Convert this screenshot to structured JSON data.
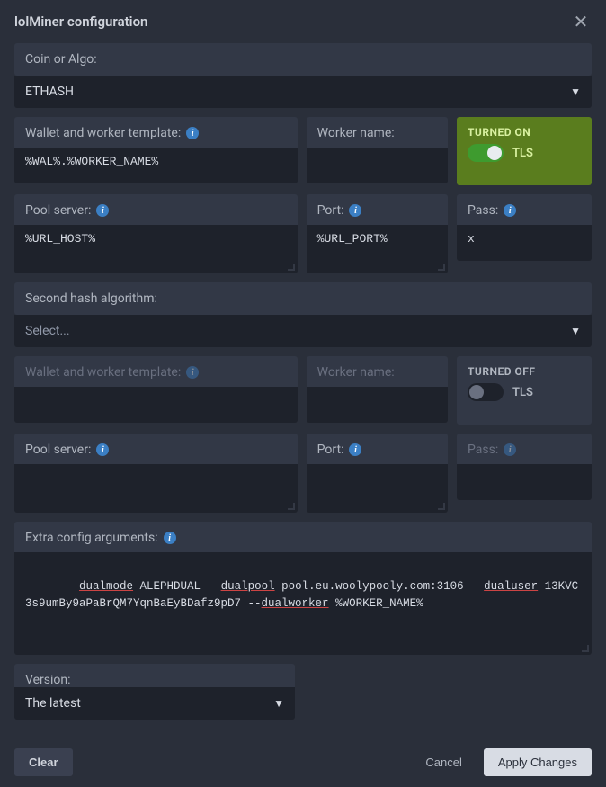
{
  "header": {
    "title": "lolMiner configuration"
  },
  "coin": {
    "label": "Coin or Algo:",
    "value": "ETHASH"
  },
  "primary": {
    "wallet": {
      "label": "Wallet and worker template:",
      "value": "%WAL%.%WORKER_NAME%"
    },
    "worker": {
      "label": "Worker name:",
      "value": ""
    },
    "tls": {
      "title": "TURNED ON",
      "label": "TLS",
      "on": true
    },
    "pool": {
      "label": "Pool server:",
      "value": "%URL_HOST%"
    },
    "port": {
      "label": "Port:",
      "value": "%URL_PORT%"
    },
    "pass": {
      "label": "Pass:",
      "value": "x"
    }
  },
  "secondAlgo": {
    "label": "Second hash algorithm:",
    "value": "Select..."
  },
  "secondary": {
    "wallet": {
      "label": "Wallet and worker template:",
      "value": ""
    },
    "worker": {
      "label": "Worker name:",
      "value": ""
    },
    "tls": {
      "title": "TURNED OFF",
      "label": "TLS",
      "on": false
    },
    "pool": {
      "label": "Pool server:",
      "value": ""
    },
    "port": {
      "label": "Port:",
      "value": ""
    },
    "pass": {
      "label": "Pass:",
      "value": ""
    }
  },
  "extra": {
    "label": "Extra config arguments:",
    "value": "--dualmode ALEPHDUAL --dualpool pool.eu.woolypooly.com:3106 --dualuser 13KVC3s9umBy9aPaBrQM7YqnBaEyBDafz9pD7 --dualworker %WORKER_NAME%"
  },
  "version": {
    "label": "Version:",
    "value": "The latest"
  },
  "footer": {
    "clear": "Clear",
    "cancel": "Cancel",
    "apply": "Apply Changes"
  }
}
